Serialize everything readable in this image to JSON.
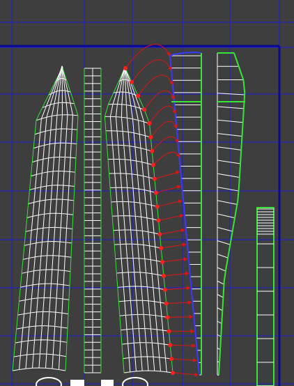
{
  "app": {
    "view_name": "uv-texture-editor-viewport"
  },
  "colors": {
    "background": "#3e3e3e",
    "grid": "#1c1cd8",
    "border": "#0a0a8c",
    "mesh": "#ffffff",
    "uv_border": "#37e437",
    "selection": "#3a3aff",
    "arrow": "#e01414",
    "vertex_selected": "#ff2020"
  }
}
